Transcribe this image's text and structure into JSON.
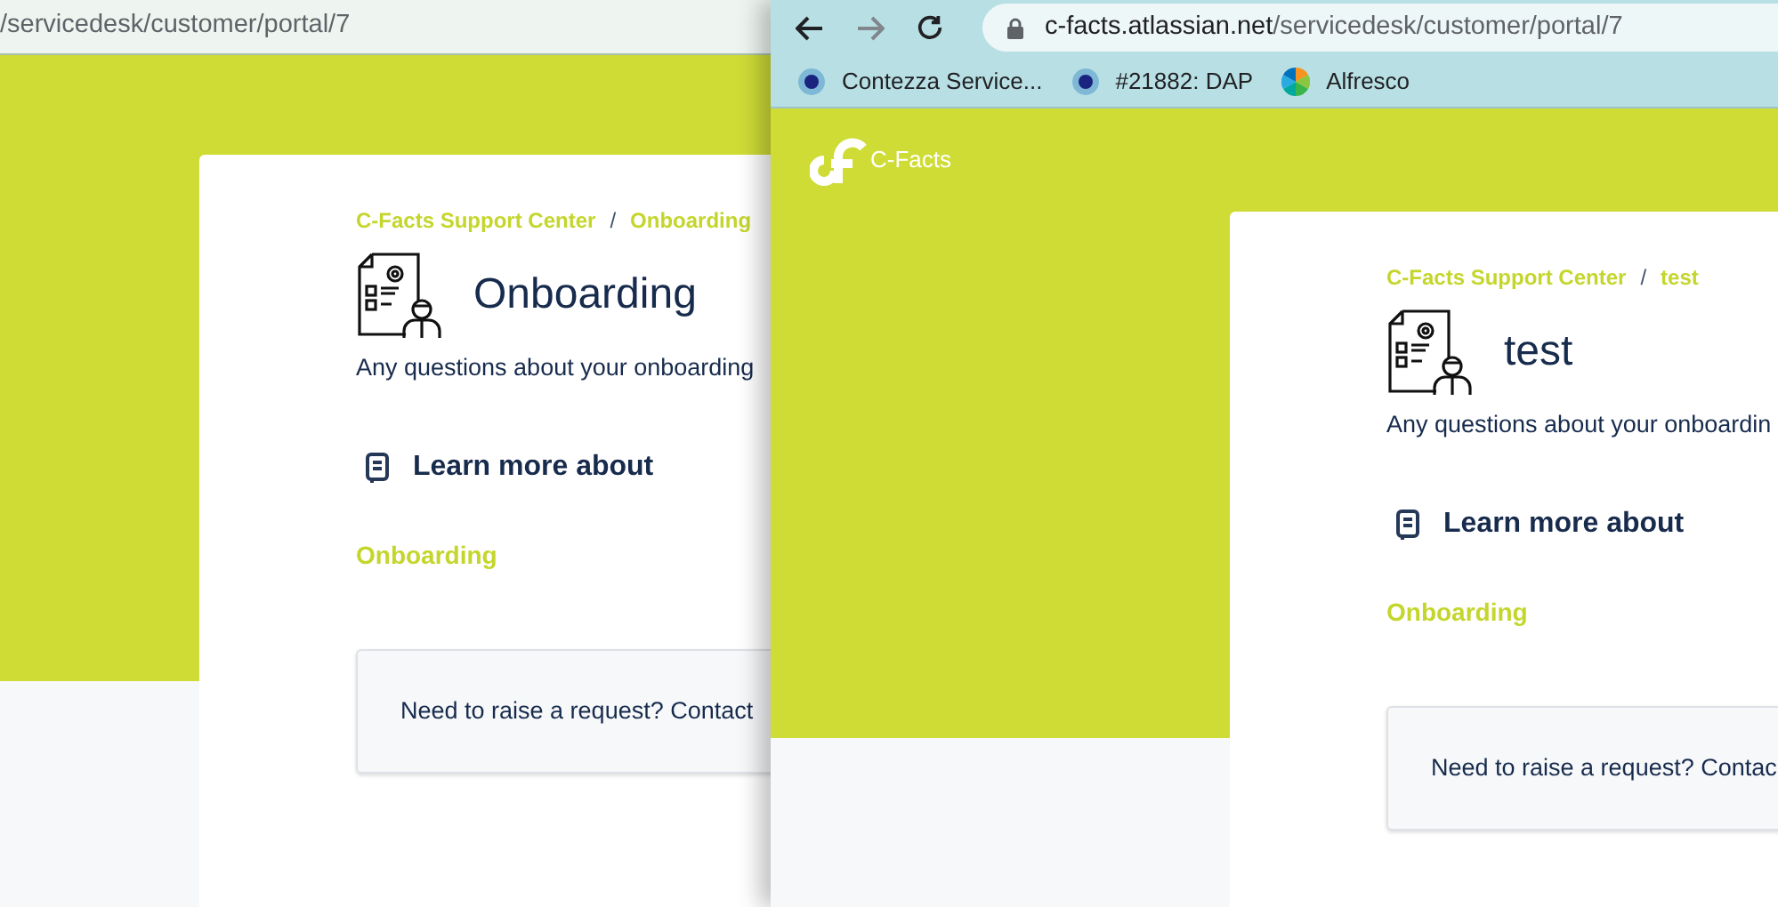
{
  "windows": [
    {
      "address_bar": {
        "url_path": "/servicedesk/customer/portal/7"
      },
      "portal": {
        "breadcrumb": [
          "C-Facts Support Center",
          "Onboarding"
        ],
        "breadcrumb_separator": "/",
        "title": "Onboarding",
        "description": "Any questions about your onboarding",
        "section_heading": "Learn more about",
        "link": "Onboarding",
        "request_prompt": "Need to raise a request? Contact"
      }
    },
    {
      "address_bar": {
        "url_host": "c-facts.atlassian.net",
        "url_path": "/servicedesk/customer/portal/7"
      },
      "bookmarks": [
        {
          "label": "Contezza Service...",
          "kind": "dots"
        },
        {
          "label": "#21882: DAP",
          "kind": "dots"
        },
        {
          "label": "Alfresco",
          "kind": "pinwheel"
        }
      ],
      "logo_text": "C-Facts",
      "portal": {
        "breadcrumb": [
          "C-Facts Support Center",
          "test"
        ],
        "breadcrumb_separator": "/",
        "title": "test",
        "description": "Any questions about your onboardin",
        "section_heading": "Learn more about",
        "link": "Onboarding",
        "request_prompt": "Need to raise a request? Contac"
      }
    }
  ]
}
